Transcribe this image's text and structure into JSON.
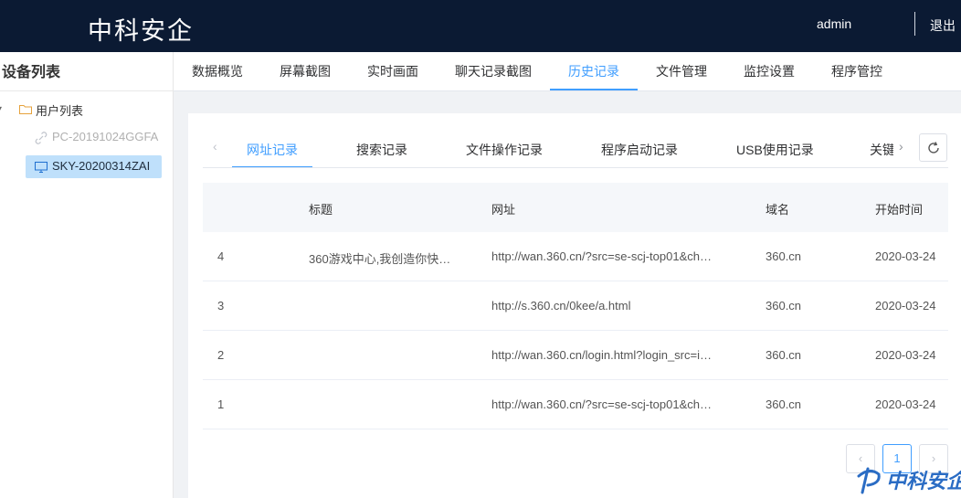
{
  "header": {
    "brand": "中科安企",
    "user": "admin",
    "logout": "退出"
  },
  "sidebar": {
    "title": "设备列表",
    "root_label": "用户列表",
    "devices": [
      {
        "name": "PC-20191024GGFA",
        "status": "offline"
      },
      {
        "name": "SKY-20200314ZAI",
        "status": "online-selected"
      }
    ]
  },
  "main_tabs": [
    "数据概览",
    "屏幕截图",
    "实时画面",
    "聊天记录截图",
    "历史记录",
    "文件管理",
    "监控设置",
    "程序管控"
  ],
  "main_tab_active": "历史记录",
  "sub_tabs": [
    "网址记录",
    "搜索记录",
    "文件操作记录",
    "程序启动记录",
    "USB使用记录"
  ],
  "sub_tab_partial": "关键",
  "sub_tab_active": "网址记录",
  "table": {
    "headers": [
      "",
      "标题",
      "网址",
      "域名",
      "开始时间"
    ],
    "rows": [
      {
        "no": "4",
        "title": "360游戏中心,我创造你快…",
        "url": "http://wan.360.cn/?src=se-scj-top01&ch…",
        "domain": "360.cn",
        "start": "2020-03-24"
      },
      {
        "no": "3",
        "title": "",
        "url": "http://s.360.cn/0kee/a.html",
        "domain": "360.cn",
        "start": "2020-03-24"
      },
      {
        "no": "2",
        "title": "",
        "url": "http://wan.360.cn/login.html?login_src=i…",
        "domain": "360.cn",
        "start": "2020-03-24"
      },
      {
        "no": "1",
        "title": "",
        "url": "http://wan.360.cn/?src=se-scj-top01&ch…",
        "domain": "360.cn",
        "start": "2020-03-24"
      }
    ]
  },
  "pagination": {
    "prev": "‹",
    "current": "1",
    "next": "›"
  },
  "watermark": {
    "text": "中科安企"
  },
  "colors": {
    "header_bg": "#0b1a33",
    "accent": "#409eff",
    "selected_node_bg": "#bfe0fb"
  }
}
